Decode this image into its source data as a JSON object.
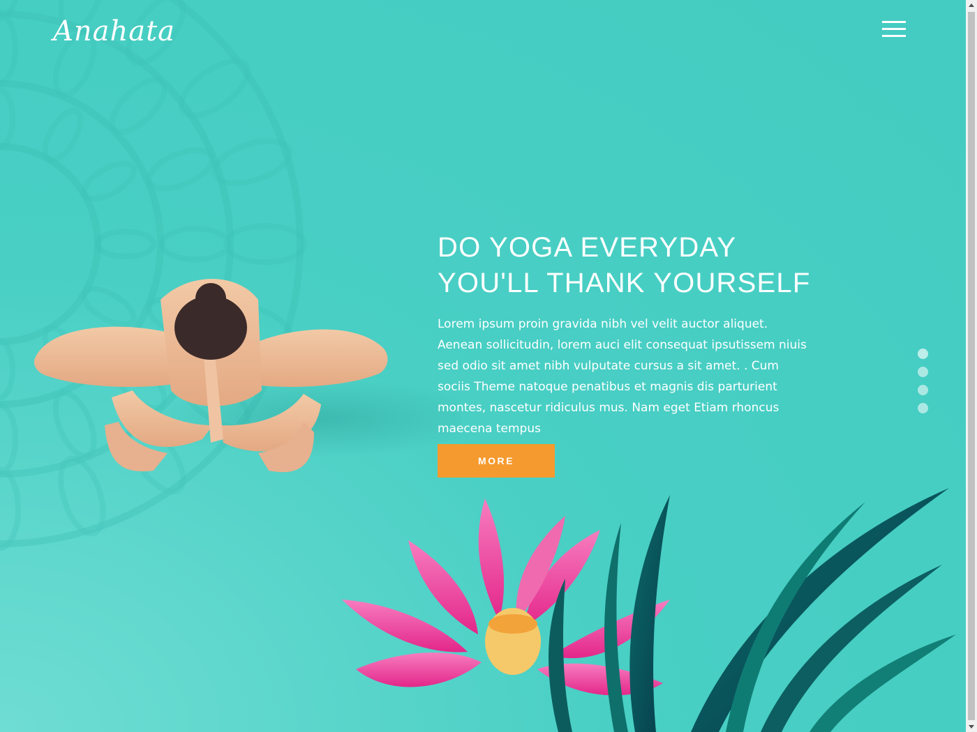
{
  "header": {
    "logo_text": "Anahata",
    "menu_icon": "hamburger-menu-icon"
  },
  "hero": {
    "title_line1": "DO YOGA EVERYDAY",
    "title_line2": "YOU'LL THANK YOURSELF",
    "body": "Lorem ipsum proin gravida nibh vel velit auctor aliquet. Aenean sollicitudin, lorem auci elit consequat ipsutissem niuis sed odio sit amet nibh vulputate cursus a sit amet. . Cum sociis Theme natoque penatibus et magnis dis parturient montes, nascetur ridiculus mus. Nam eget Etiam rhoncus maecena tempus",
    "button_label": "MORE"
  },
  "slider": {
    "dot_count": 4,
    "active_index": 0
  },
  "colors": {
    "background": "#47cdc3",
    "button": "#f59a2f",
    "text": "#ffffff"
  }
}
